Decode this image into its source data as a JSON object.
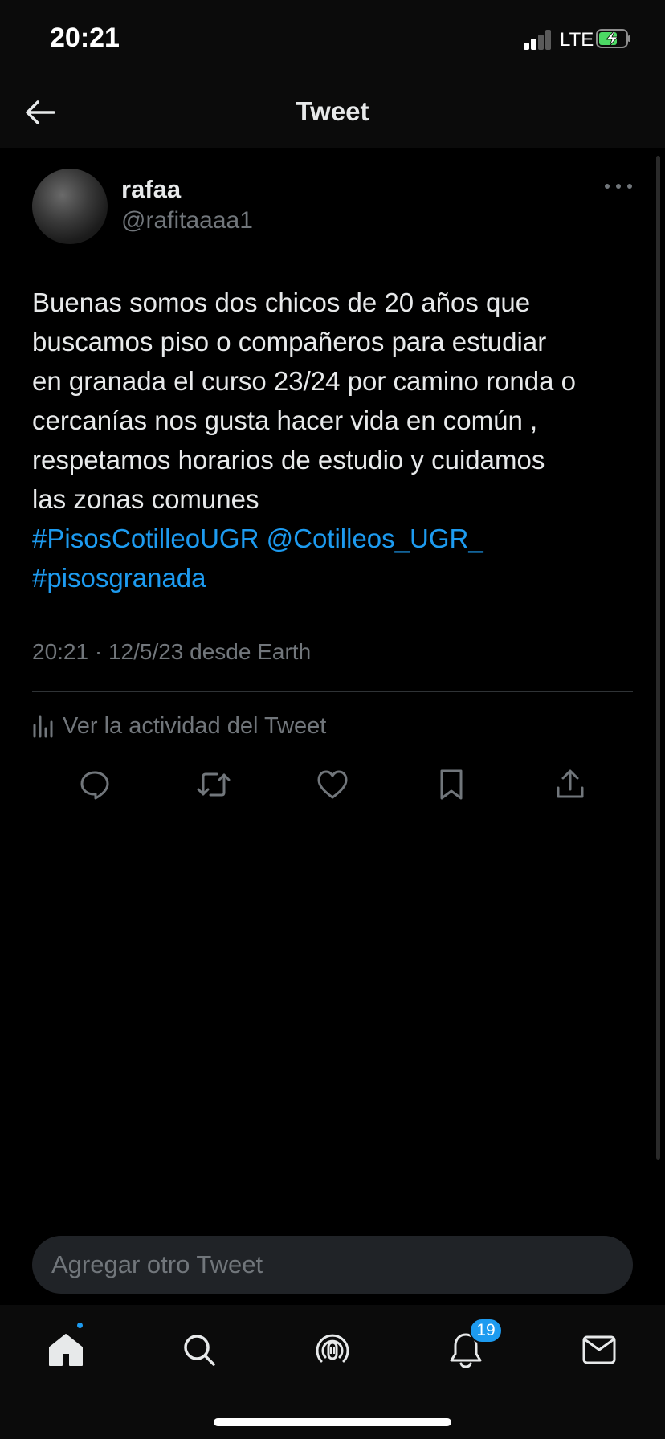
{
  "status_bar": {
    "time": "20:21",
    "network": "LTE"
  },
  "nav": {
    "title": "Tweet",
    "back_icon": "arrow-left-icon"
  },
  "tweet": {
    "author": {
      "name": "rafaa",
      "handle": "@rafitaaaa1"
    },
    "text_lines": [
      "Buenas somos dos chicos de 20 años que",
      "buscamos piso o compañeros para estudiar",
      "en granada el curso 23/24 por camino ronda o",
      "cercanías nos gusta hacer vida en común ,",
      "respetamos horarios de estudio y cuidamos",
      "las zonas comunes"
    ],
    "links": {
      "hashtag_1": "#PisosCotilleoUGR",
      "mention": "@Cotilleos_UGR_",
      "hashtag_2": "#pisosgranada"
    },
    "timestamp": "20:21 · 12/5/23 desde Earth",
    "activity_label": "Ver la actividad del Tweet",
    "actions": [
      "reply-icon",
      "retweet-icon",
      "like-icon",
      "bookmark-icon",
      "share-icon"
    ]
  },
  "reply": {
    "placeholder": "Agregar otro Tweet"
  },
  "tab_bar": {
    "tabs": [
      "home-icon",
      "search-icon",
      "spaces-icon",
      "notifications-icon",
      "messages-icon"
    ],
    "notifications_badge": "19"
  },
  "colors": {
    "link": "#1d9bf0",
    "text_primary": "#e7e9ea",
    "text_secondary": "#71767b",
    "background": "#000000"
  }
}
